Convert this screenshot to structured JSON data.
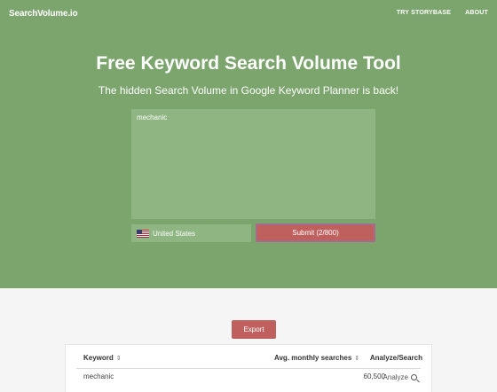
{
  "header": {
    "brand": "SearchVolume.io",
    "nav": [
      "TRY STORYBASE",
      "ABOUT"
    ]
  },
  "hero": {
    "title_part1": "Free Keyword ",
    "title_bold": "Search Volume",
    "title_part2": " Tool",
    "subtitle": "The hidden Search Volume in Google Keyword Planner is back!",
    "keywords_value": "mechanic",
    "country": "United States",
    "submit_label": "Submit (2/800)"
  },
  "results": {
    "export_label": "Export",
    "columns": [
      "Keyword",
      "Avg. monthly searches",
      "Analyze/Search"
    ],
    "sort_glyph": "⇕",
    "rows": [
      {
        "keyword": "mechanic",
        "searches": "60,500",
        "action": "Analyze"
      }
    ]
  },
  "colors": {
    "hero_bg": "#7ba56d",
    "input_bg": "#8fb583",
    "accent_red": "#c0605e"
  }
}
